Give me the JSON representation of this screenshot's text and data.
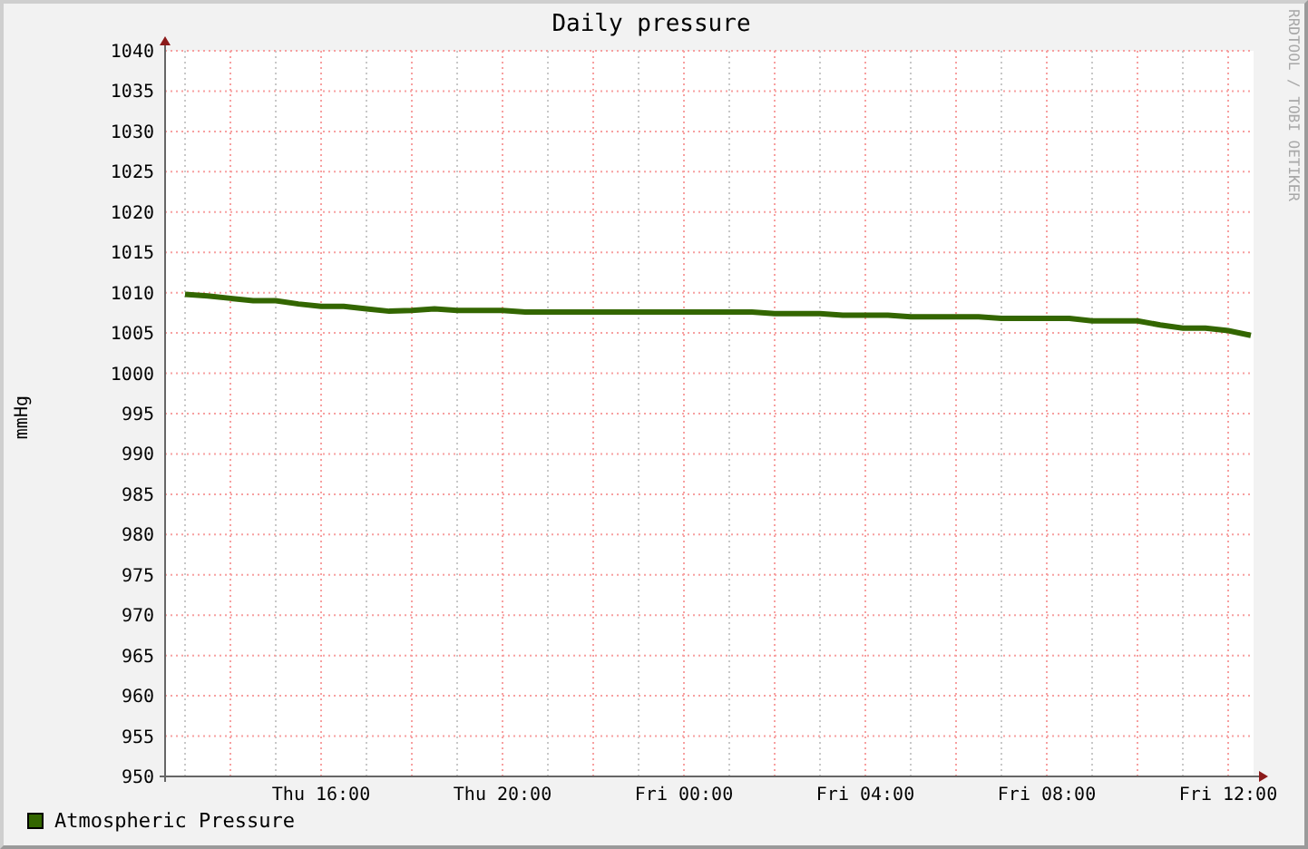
{
  "title": "Daily pressure",
  "credit": "RRDTOOL / TOBI OETIKER",
  "chart": {
    "chart_data": {
      "type": "line",
      "ylabel": "mmHg",
      "ylim": [
        950,
        1040
      ],
      "grid": true,
      "yticks": [
        950,
        955,
        960,
        965,
        970,
        975,
        980,
        985,
        990,
        995,
        1000,
        1005,
        1010,
        1015,
        1020,
        1025,
        1030,
        1035,
        1040
      ],
      "categories": [
        null,
        null,
        null,
        null,
        null,
        null,
        "Thu 16:00",
        null,
        null,
        null,
        null,
        null,
        null,
        null,
        "Thu 20:00",
        null,
        null,
        null,
        null,
        null,
        null,
        null,
        "Fri 00:00",
        null,
        null,
        null,
        null,
        null,
        null,
        null,
        "Fri 04:00",
        null,
        null,
        null,
        null,
        null,
        null,
        null,
        "Fri 08:00",
        null,
        null,
        null,
        null,
        null,
        null,
        null,
        "Fri 12:00",
        null
      ],
      "series": [
        {
          "name": "Atmospheric Pressure",
          "color": "#336600",
          "values": [
            1009.8,
            1009.6,
            1009.3,
            1009.0,
            1009.0,
            1008.6,
            1008.3,
            1008.3,
            1008.0,
            1007.7,
            1007.8,
            1008.0,
            1007.8,
            1007.8,
            1007.8,
            1007.6,
            1007.6,
            1007.6,
            1007.6,
            1007.6,
            1007.6,
            1007.6,
            1007.6,
            1007.6,
            1007.6,
            1007.6,
            1007.4,
            1007.4,
            1007.4,
            1007.2,
            1007.2,
            1007.2,
            1007.0,
            1007.0,
            1007.0,
            1007.0,
            1006.8,
            1006.8,
            1006.8,
            1006.8,
            1006.5,
            1006.5,
            1006.5,
            1006.0,
            1005.6,
            1005.6,
            1005.3,
            1004.7
          ]
        }
      ]
    }
  }
}
